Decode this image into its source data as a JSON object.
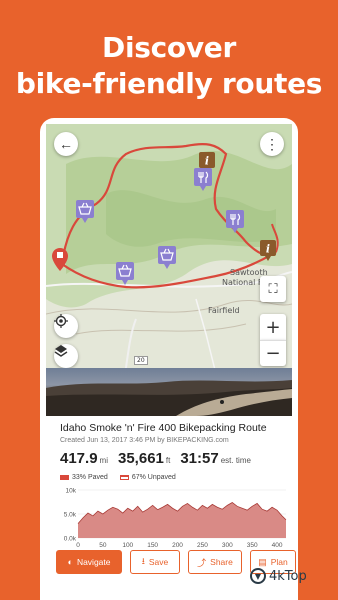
{
  "headline": {
    "line1": "Discover",
    "line2": "bike-friendly routes"
  },
  "map": {
    "back_icon": "←",
    "more_icon": "⋮",
    "fullscreen_icon": "⛶",
    "zoom_in_label": "+",
    "zoom_out_label": "−",
    "place_labels": {
      "national_forest_1": "Sawtooth",
      "national_forest_2": "National Forest",
      "town": "Fairfield",
      "highway_shield": "20"
    },
    "route_color": "#d9483b"
  },
  "route": {
    "title": "Idaho Smoke 'n' Fire 400 Bikepacking Route",
    "meta": "Created Jun 13, 2017 3:46 PM by BIKEPACKING.com",
    "distance_value": "417.9",
    "distance_unit": "mi",
    "elevation_value": "35,661",
    "elevation_unit": "ft",
    "time_value": "31:57",
    "time_unit": "est. time"
  },
  "legend": {
    "paved": "33% Paved",
    "unpaved": "67% Unpaved"
  },
  "chart_data": {
    "type": "area",
    "y_ticks": [
      "10k",
      "5.0k",
      "0.0k"
    ],
    "x_ticks": [
      "0",
      "50",
      "100",
      "150",
      "200",
      "250",
      "300",
      "350",
      "400"
    ],
    "ylim": [
      0,
      10000
    ],
    "xlim": [
      0,
      418
    ],
    "x": [
      0,
      10,
      20,
      30,
      40,
      50,
      60,
      70,
      80,
      90,
      100,
      110,
      120,
      130,
      140,
      150,
      160,
      170,
      180,
      190,
      200,
      210,
      220,
      230,
      240,
      250,
      260,
      270,
      280,
      290,
      300,
      310,
      320,
      330,
      340,
      350,
      360,
      370,
      380,
      390,
      400,
      410,
      418
    ],
    "values": [
      3000,
      4200,
      5200,
      4600,
      5600,
      5000,
      5800,
      6400,
      6000,
      5200,
      6200,
      5600,
      6600,
      5400,
      6000,
      6800,
      5900,
      6400,
      7000,
      6200,
      5600,
      6600,
      7200,
      6400,
      5800,
      6800,
      6200,
      7000,
      6400,
      6000,
      6800,
      7400,
      6600,
      6200,
      5800,
      6600,
      7200,
      6000,
      5600,
      6400,
      5800,
      4600,
      3800
    ],
    "colors": {
      "fill": "#d98a86",
      "line": "#a83a36"
    }
  },
  "actions": {
    "navigate": "Navigate",
    "save": "Save",
    "share": "Share",
    "plan": "Plan"
  },
  "watermark": {
    "text": "4kTop"
  }
}
